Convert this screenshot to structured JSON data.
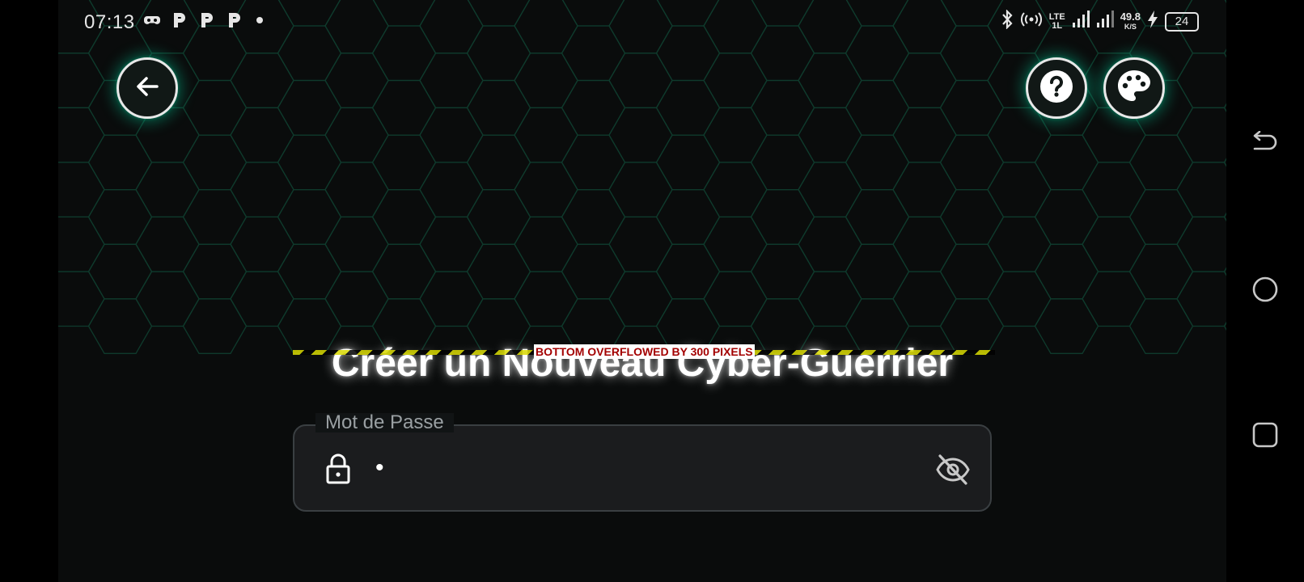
{
  "status_bar": {
    "time": "07:13",
    "lte_top": "LTE",
    "lte_bottom": "1L",
    "net_speed_value": "49.8",
    "net_speed_unit": "K/S",
    "battery": "24"
  },
  "header": {
    "back_icon": "arrow-left-icon",
    "help_icon": "question-circle-icon",
    "theme_icon": "palette-icon"
  },
  "debug": {
    "overflow_label": "BOTTOM OVERFLOWED BY 300 PIXELS"
  },
  "main": {
    "title": "Créer un Nouveau Cyber-Guerrier",
    "password_field": {
      "label": "Mot de Passe",
      "value": "•",
      "lock_icon": "lock-icon",
      "toggle_icon": "eye-off-icon"
    }
  },
  "colors": {
    "background": "#0a0c0c",
    "hex_stroke": "#0f3a2c",
    "glow": "#00c896",
    "overflow_stripe": "#d8d800",
    "overflow_text": "#a30000"
  }
}
